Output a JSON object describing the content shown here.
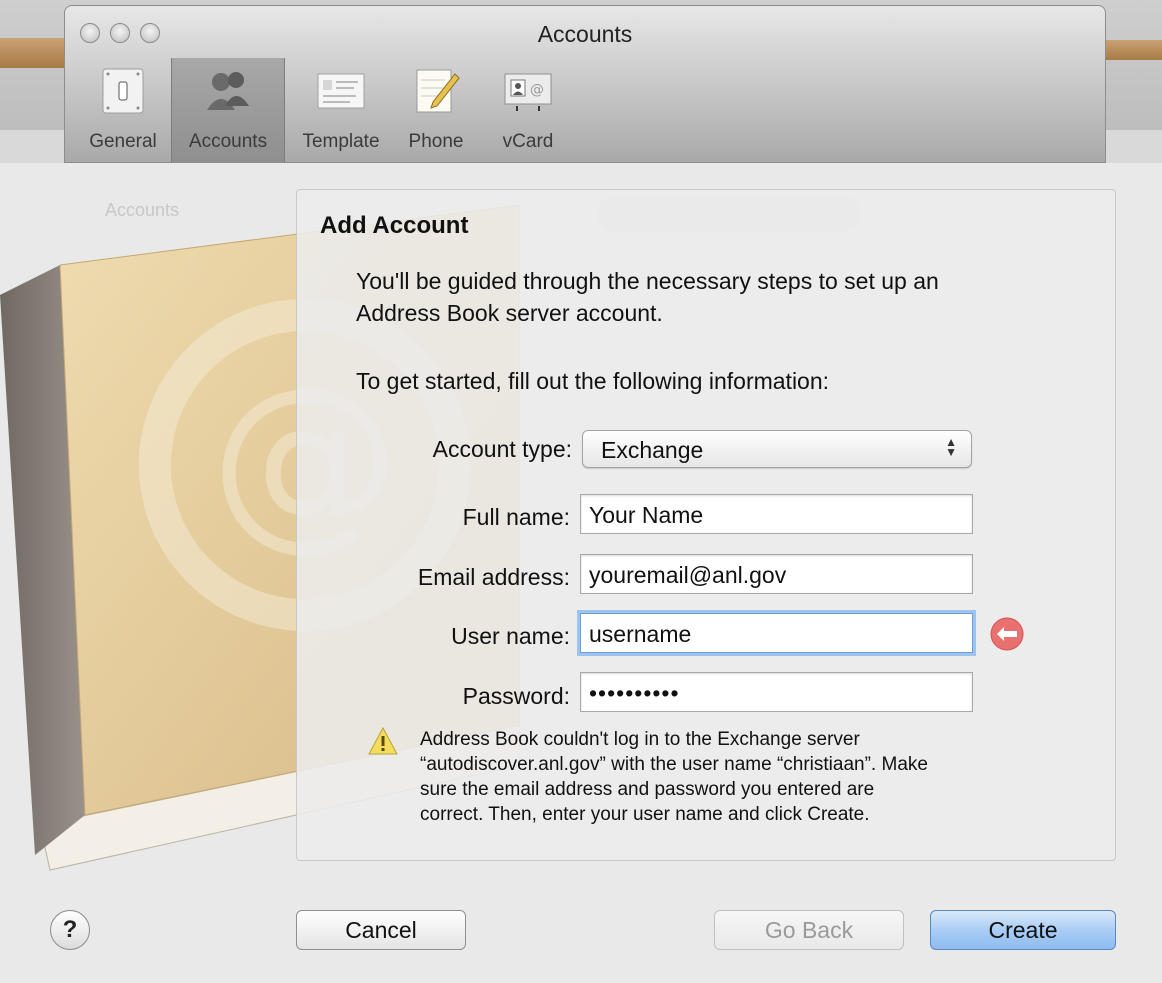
{
  "window": {
    "title": "Accounts"
  },
  "toolbar": {
    "items": [
      {
        "label": "General",
        "icon": "switch-icon"
      },
      {
        "label": "Accounts",
        "icon": "people-icon",
        "selected": true
      },
      {
        "label": "Template",
        "icon": "card-template-icon"
      },
      {
        "label": "Phone",
        "icon": "notepad-pencil-icon"
      },
      {
        "label": "vCard",
        "icon": "vcard-icon"
      }
    ]
  },
  "sheet": {
    "title": "Add Account",
    "intro_line1": "You'll be guided through the necessary steps to set up an",
    "intro_line2": "Address Book server account.",
    "instruction": "To get started, fill out the following information:",
    "form": {
      "account_type_label": "Account type:",
      "account_type_value": "Exchange",
      "full_name_label": "Full name:",
      "full_name_value": "Your Name",
      "email_label": "Email address:",
      "email_value": "youremail@anl.gov",
      "username_label": "User name:",
      "username_value": "username",
      "password_label": "Password:",
      "password_value": "••••••••••"
    },
    "warning": {
      "line1": "Address Book couldn't log in to the Exchange server",
      "line2": "“autodiscover.anl.gov” with the user name “christiaan”. Make",
      "line3": "sure the email address and password you entered are",
      "line4": "correct. Then, enter your user name and click Create."
    }
  },
  "buttons": {
    "help": "?",
    "cancel": "Cancel",
    "go_back": "Go Back",
    "create": "Create"
  },
  "colors": {
    "accent": "#8fbcef",
    "error": "#e8706f",
    "warning": "#f3dd5a",
    "book_cover": "#e4cc99",
    "book_spine": "#8d857d"
  }
}
